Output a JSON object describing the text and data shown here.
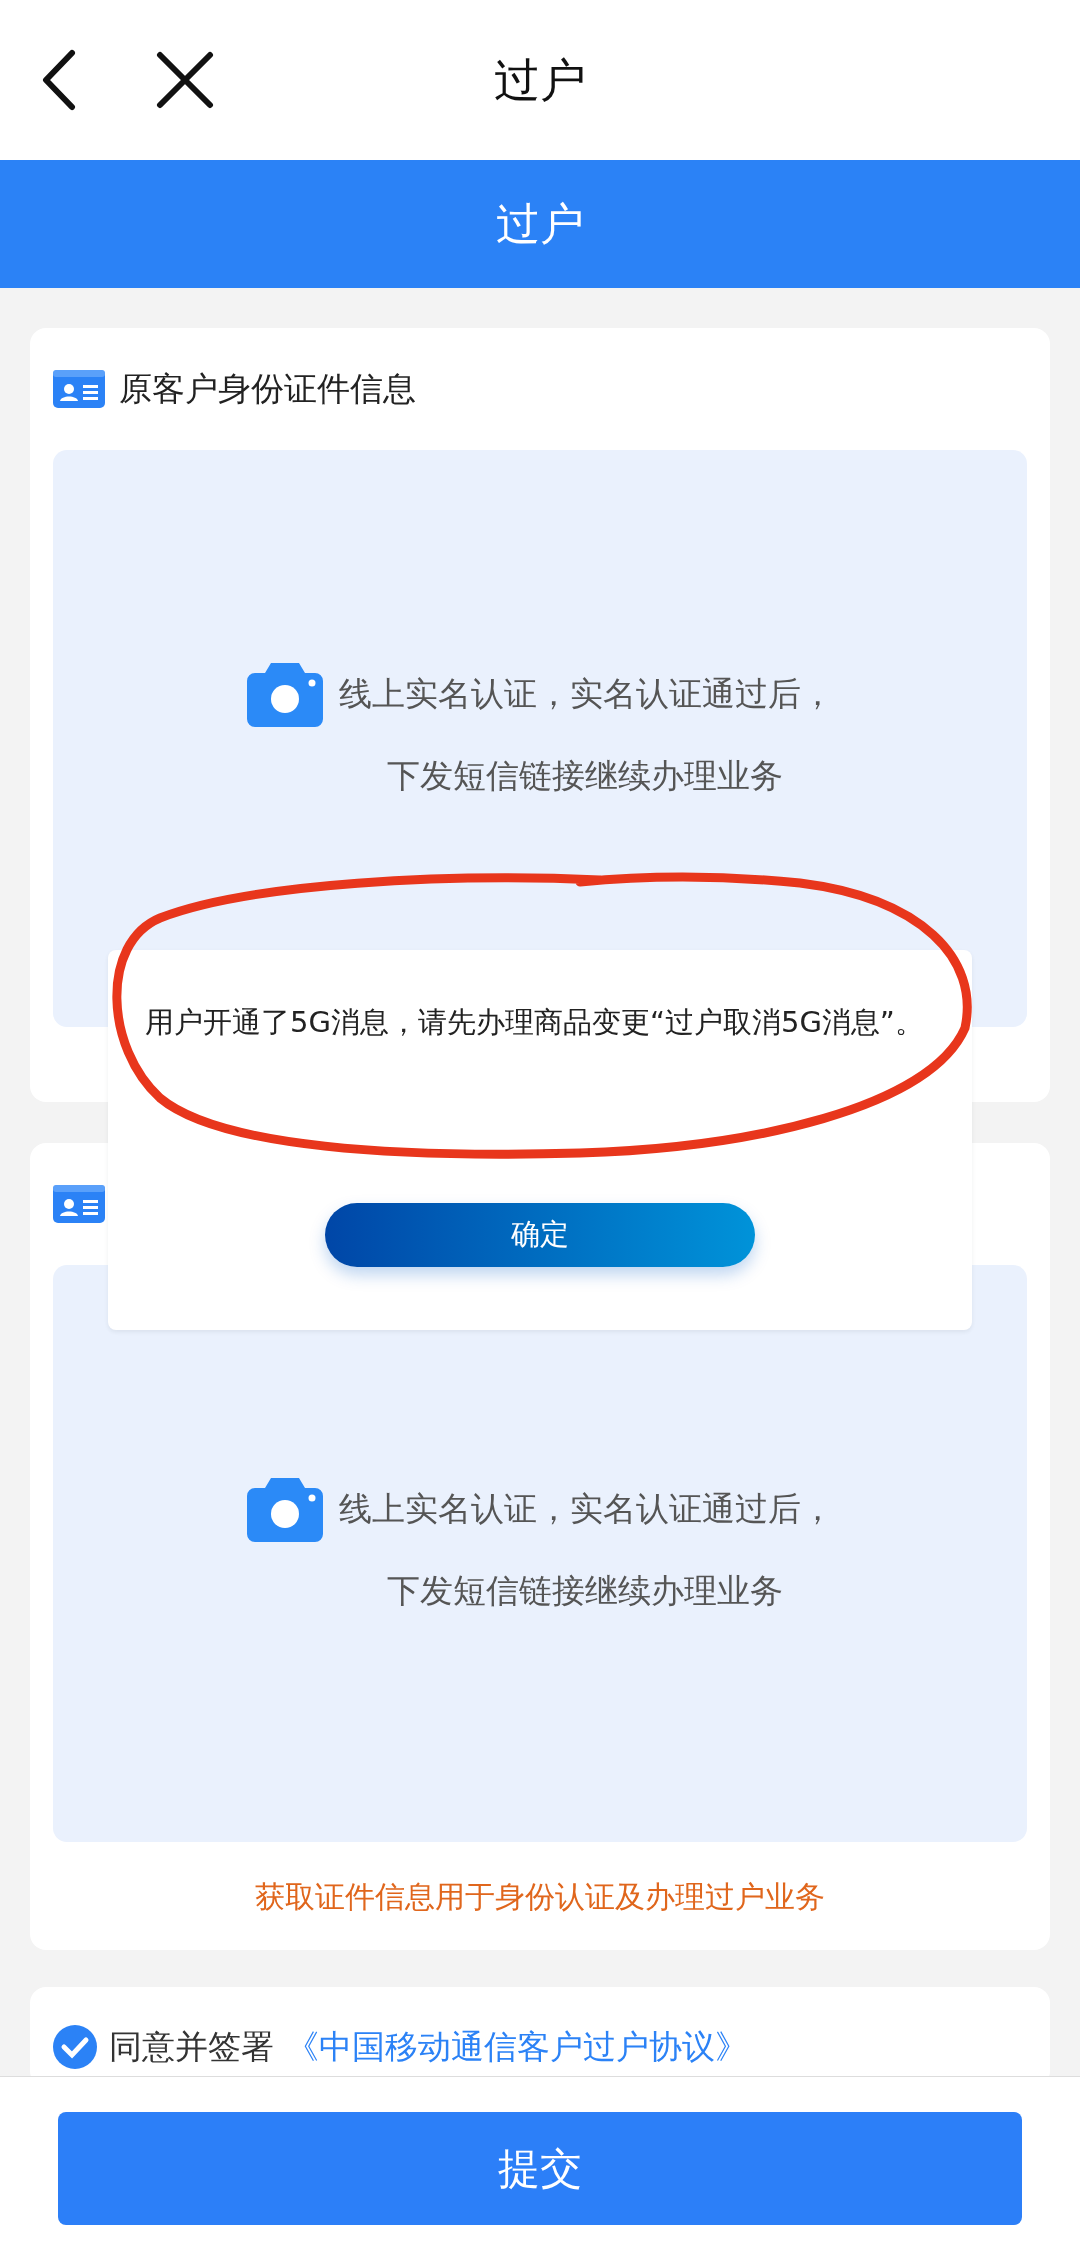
{
  "nav": {
    "title": "过户"
  },
  "header": {
    "title": "过户"
  },
  "cards": [
    {
      "title": "原客户身份证件信息",
      "upload_lines": [
        "线上实名认证，实名认证通过后，",
        "下发短信链接继续办理业务"
      ]
    },
    {
      "upload_lines": [
        "线上实名认证，实名认证通过后，",
        "下发短信链接继续办理业务"
      ],
      "caption": "获取证件信息用于身份认证及办理过户业务"
    }
  ],
  "agreement": {
    "checked": true,
    "prefix": "同意并签署",
    "link": "《中国移动通信客户过户协议》"
  },
  "dialog": {
    "message": "用户开通了5G消息，请先办理商品变更“过户取消5G消息”。",
    "button": "确定"
  },
  "footer": {
    "button": "提交"
  }
}
